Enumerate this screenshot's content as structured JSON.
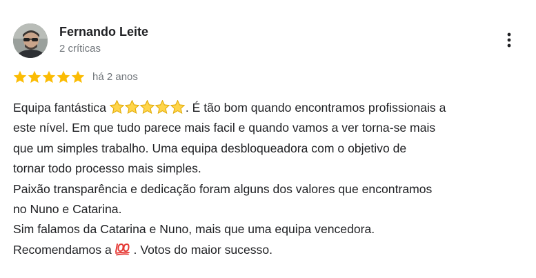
{
  "review": {
    "author": {
      "name": "Fernando Leite",
      "meta": "2 críticas",
      "avatar_icon": "user-avatar-photo"
    },
    "more_icon": "more-vertical-icon",
    "rating": {
      "stars": 5,
      "max_stars": 5,
      "star_color": "#fbbc04",
      "time": "há 2 anos"
    },
    "body": {
      "line1_before": "Equipa fantástica ",
      "line1_emoji": "five-star-emoji-icons",
      "line1_after": ". É tão bom quando encontramos profissionais a",
      "line2": "este nível. Em que tudo parece mais facil e quando vamos a ver torna-se mais",
      "line3": "que um simples trabalho. Uma equipa desbloqueadora com o objetivo de",
      "line4": "tornar todo processo mais simples.",
      "line5": "Paixão transparência e dedicação foram alguns dos valores que encontramos",
      "line6": "no Nuno e Catarina.",
      "line7": "Sim falamos da Catarina e Nuno, mais que uma equipa vencedora.",
      "line8_before": "Recomendamos a ",
      "line8_emoji": "hundred-points-emoji-icon",
      "line8_after": " . Votos do maior sucesso."
    }
  }
}
